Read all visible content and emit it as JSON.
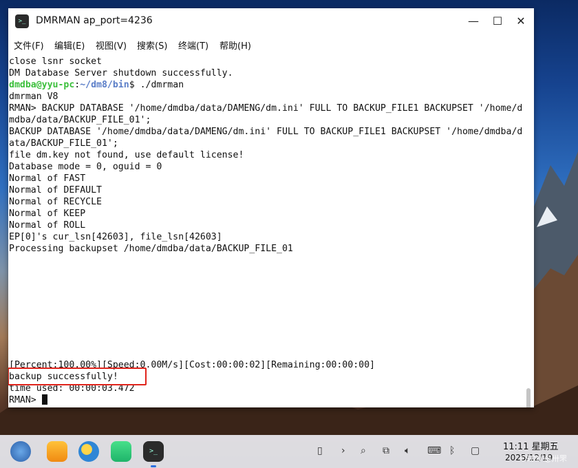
{
  "window": {
    "title": "DMRMAN ap_port=4236",
    "app_icon_text": ">_",
    "buttons": {
      "minimize": "—",
      "maximize": "☐",
      "close": "✕"
    }
  },
  "menu": [
    "文件(F)",
    "编辑(E)",
    "视图(V)",
    "搜索(S)",
    "终端(T)",
    "帮助(H)"
  ],
  "terminal": {
    "lines": [
      "close lsnr socket",
      "DM Database Server shutdown successfully.",
      "",
      "dmrman V8",
      "RMAN> BACKUP DATABASE '/home/dmdba/data/DAMENG/dm.ini' FULL TO BACKUP_FILE1 BACKUPSET '/home/d",
      "mdba/data/BACKUP_FILE_01';",
      "BACKUP DATABASE '/home/dmdba/data/DAMENG/dm.ini' FULL TO BACKUP_FILE1 BACKUPSET '/home/dmdba/d",
      "ata/BACKUP_FILE_01';",
      "file dm.key not found, use default license!",
      "Database mode = 0, oguid = 0",
      "Normal of FAST",
      "Normal of DEFAULT",
      "Normal of RECYCLE",
      "Normal of KEEP",
      "Normal of ROLL",
      "EP[0]'s cur_lsn[42603], file_lsn[42603]",
      "Processing backupset /home/dmdba/data/BACKUP_FILE_01"
    ],
    "prompt": {
      "user": "dmdba@yyu-pc",
      "sep": ":",
      "path": "~/dm8/bin",
      "symbol": "$ ",
      "command": "./dmrman"
    },
    "progress": "[Percent:100.00%][Speed:0.00M/s][Cost:00:00:02][Remaining:00:00:00]",
    "result": "backup successfully!",
    "time_used": "time used: 00:00:03.472",
    "rman_prompt": "RMAN> "
  },
  "taskbar": {
    "apps": [
      "launcher",
      "file-manager",
      "browser",
      "app-store",
      "terminal"
    ],
    "tray_icons": [
      "clipboard-icon",
      "chevron-right-icon",
      "search-icon",
      "screenshot-icon",
      "volume-icon",
      "keyboard-icon",
      "bluetooth-off-icon",
      "notification-icon"
    ],
    "time": "11:11 星期五",
    "date": "2025/12/19",
    "watermark": "CSDN @卅罘"
  },
  "colors": {
    "prompt_user": "#3bbf3b",
    "prompt_path": "#5b7ec8",
    "highlight_box": "#e0231b"
  }
}
